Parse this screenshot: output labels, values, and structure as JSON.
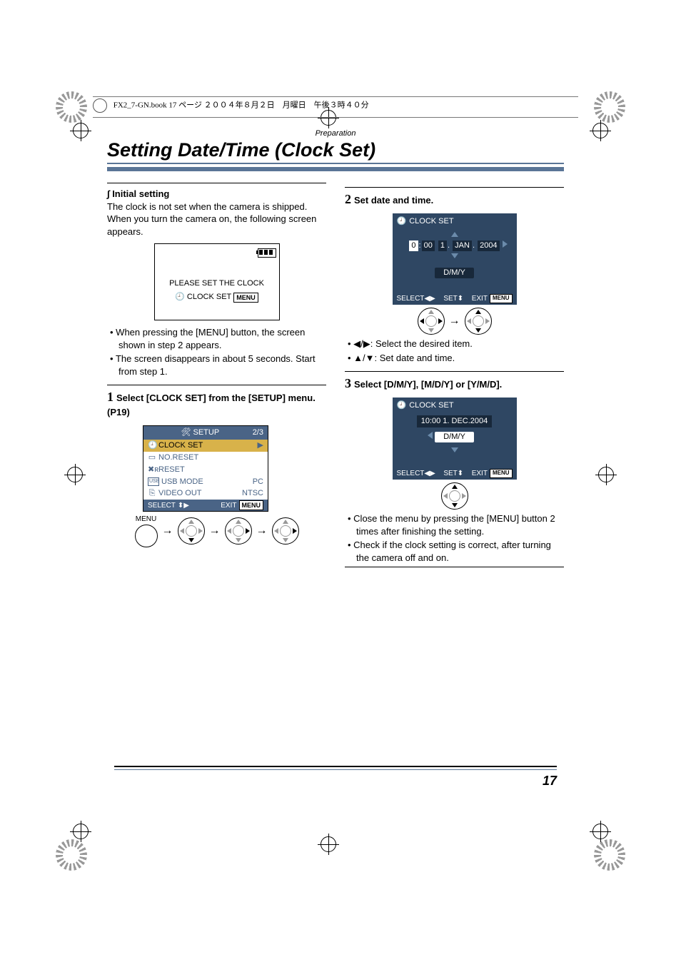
{
  "meta": {
    "header_line": "FX2_7-GN.book  17 ページ  ２００４年８月２日　月曜日　午後３時４０分"
  },
  "section_label": "Preparation",
  "title": "Setting Date/Time (Clock Set)",
  "page_number": "17",
  "left": {
    "initial_heading": "Initial setting",
    "intro": "The clock is not set when the camera is shipped. When you turn the camera on, the following screen appears.",
    "screen1_line1": "PLEASE SET THE CLOCK",
    "screen1_line2_pre": "CLOCK SET",
    "screen1_menu_badge": "MENU",
    "bullets": [
      "When pressing the [MENU] button, the screen shown in step 2 appears.",
      "The screen disappears in about 5 seconds. Start from step 1."
    ],
    "step1_text": "Select [CLOCK SET] from the [SETUP] menu. (P19)",
    "setup_title": "SETUP",
    "setup_page": "2/3",
    "setup_items": [
      {
        "label": "CLOCK SET",
        "value": "",
        "selected": true
      },
      {
        "label": "NO.RESET",
        "value": ""
      },
      {
        "label": "RESET",
        "value": ""
      },
      {
        "label": "USB MODE",
        "value": "PC"
      },
      {
        "label": "VIDEO OUT",
        "value": "NTSC"
      }
    ],
    "setup_select": "SELECT",
    "setup_exit": "EXIT",
    "menu_label": "MENU"
  },
  "right": {
    "step2_text": "Set date and time.",
    "cs_title": "CLOCK SET",
    "cs_fields": {
      "hour": "0",
      "colon": ":",
      "min": "00",
      "day": "1",
      "dot": ".",
      "mon": "JAN",
      "dot2": ".",
      "year": "2004"
    },
    "cs_dmy": "D/M/Y",
    "cs_select": "SELECT",
    "cs_set": "SET",
    "cs_exit": "EXIT",
    "cs_menu": "MENU",
    "notes2": [
      {
        "glyph": "lr",
        "text": "Select the desired item."
      },
      {
        "glyph": "ud",
        "text": "Set date and time."
      }
    ],
    "step3_text": "Select [D/M/Y], [M/D/Y] or [Y/M/D].",
    "cs3_date": "10:00  1.  DEC.2004",
    "bullets3": [
      "Close the menu by pressing the [MENU] button 2 times after finishing the setting.",
      "Check if the clock setting is correct, after turning the camera off and on."
    ]
  }
}
